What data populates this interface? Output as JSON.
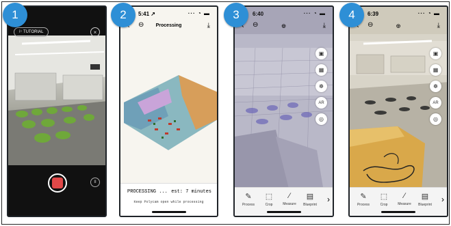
{
  "panels": [
    {
      "badge": "1",
      "tutorial_label": "TUTORIAL",
      "close_icon": "close-icon",
      "pause_glyph": "II",
      "record_color": "#e04848"
    },
    {
      "badge": "2",
      "time": "5:41 ↗",
      "status_icons": "··· ◔ ▬",
      "title": "Processing",
      "processing_label": "PROCESSING ...",
      "estimate": "est: 7 minutes",
      "hint": "Keep Polycam open while processing"
    },
    {
      "badge": "3",
      "time": "6:40",
      "status_icons": "··· ◔ ▬",
      "side_buttons": [
        "▣",
        "▦",
        "☸",
        "AR",
        "◎"
      ],
      "tools": [
        {
          "icon": "✎",
          "label": "Process"
        },
        {
          "icon": "⬚",
          "label": "Crop"
        },
        {
          "icon": "∕",
          "label": "Measure"
        },
        {
          "icon": "▤",
          "label": "Blueprint"
        }
      ],
      "more": "›"
    },
    {
      "badge": "4",
      "time": "6:39",
      "status_icons": "··· ◔ ▬",
      "side_buttons": [
        "▣",
        "▦",
        "☸",
        "AR",
        "◎"
      ],
      "tools": [
        {
          "icon": "✎",
          "label": "Process"
        },
        {
          "icon": "⬚",
          "label": "Crop"
        },
        {
          "icon": "∕",
          "label": "Measure"
        },
        {
          "icon": "▤",
          "label": "Blueprint"
        }
      ],
      "more": "›"
    }
  ]
}
